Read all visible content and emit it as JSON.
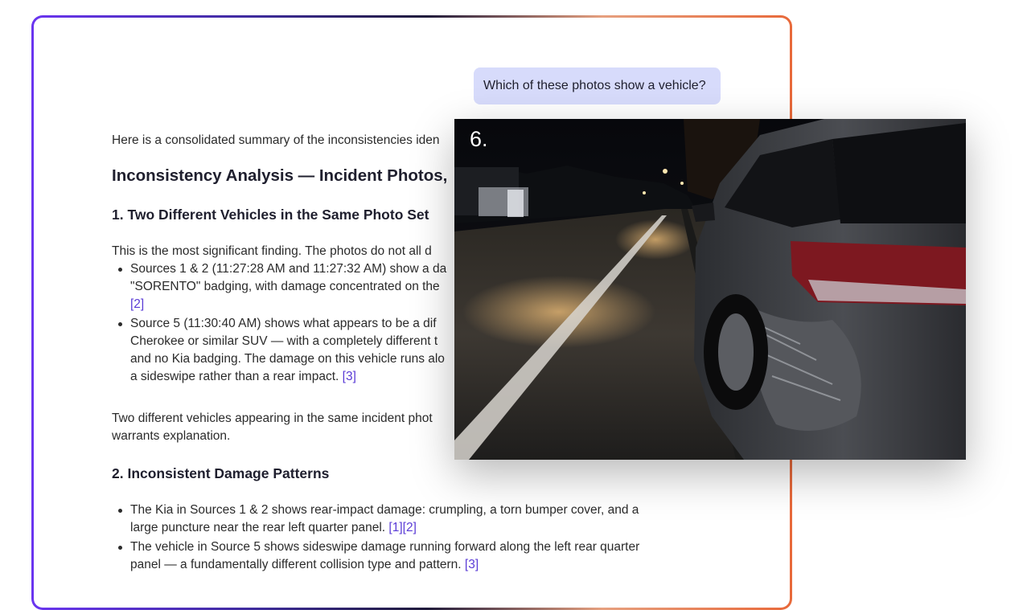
{
  "user_message": "Which of these photos show a vehicle?",
  "answer": {
    "intro": "Here is a consolidated summary of the inconsistencies iden",
    "title": "Inconsistency Analysis — Incident Photos,",
    "section1": {
      "heading": "1. Two Different Vehicles in the Same Photo Set",
      "lead": "This is the most significant finding. The photos do not all d",
      "bullets": [
        {
          "lines": [
            "Sources 1 & 2 (11:27:28 AM and 11:27:32 AM) show a da",
            "\"SORENTO\" badging, with damage concentrated on the"
          ],
          "cite": "[2]"
        },
        {
          "lines": [
            "Source 5 (11:30:40 AM) shows what appears to be a dif",
            "Cherokee or similar SUV — with a completely different t",
            "and no Kia badging. The damage on this vehicle runs alo",
            "a sideswipe rather than a rear impact."
          ],
          "cite": "[3]"
        }
      ],
      "closing_lines": [
        "Two different vehicles appearing in the same incident phot",
        "warrants explanation."
      ]
    },
    "section2": {
      "heading": "2. Inconsistent Damage Patterns",
      "bullets": [
        {
          "lines": [
            "The Kia in Sources 1 & 2 shows rear-impact damage: crumpling, a torn bumper cover, and a",
            "large puncture near the rear left quarter panel."
          ],
          "cite": "[1][2]"
        },
        {
          "lines": [
            "The vehicle in Source 5 shows sideswipe damage running forward along the left rear quarter",
            "panel — a fundamentally different collision type and pattern."
          ],
          "cite": "[3]"
        }
      ]
    }
  },
  "photo_preview": {
    "index_label": "6.",
    "icon": "photo-damaged-suv-night-road"
  },
  "colors": {
    "frame_gradient": [
      "#6a35f0",
      "#1f1a3a",
      "#e8693a"
    ],
    "user_bubble": "#d7dbfb",
    "citation": "#5a3bd6"
  }
}
